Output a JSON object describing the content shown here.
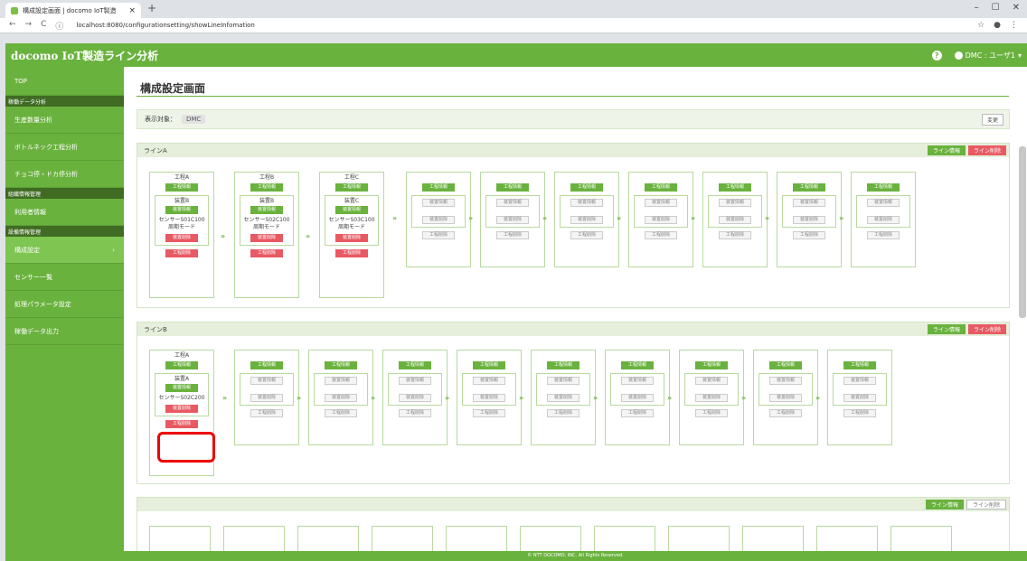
{
  "browser": {
    "tab_title": "構成設定画面 | docomo IoT製造",
    "url": "localhost:8080/configurationsetting/showLineInfomation"
  },
  "header": {
    "app_title": "docomo IoT製造ライン分析",
    "user": "DMC : ユーザ1"
  },
  "sidebar": {
    "top": "TOP",
    "group1": "稼働データ分析",
    "item_production": "生産数量分析",
    "item_bottleneck": "ボトルネック工程分析",
    "item_choko": "チョコ停・ドカ停分析",
    "group2": "組織情報管理",
    "item_users": "利用者情報",
    "group3": "設備情報管理",
    "item_config": "構成設定",
    "item_sensors": "センサー一覧",
    "item_params": "処理パラメータ設定",
    "item_export": "稼働データ出力"
  },
  "main": {
    "title": "構成設定画面",
    "target_label": "表示対象：",
    "target_value": "DMC",
    "change_btn": "変更",
    "line_info": "ライン情報",
    "line_delete": "ライン削除",
    "proc_info": "工程情報",
    "proc_delete": "工程削除",
    "dev_info": "装置情報",
    "dev_delete": "装置削除"
  },
  "lineA": {
    "name": "ラインA",
    "processes": [
      {
        "name": "工程A",
        "device": "装置B",
        "sensor1": "センサーS01C100",
        "sensor2": "周期モード"
      },
      {
        "name": "工程B",
        "device": "装置B",
        "sensor1": "センサーS02C100",
        "sensor2": "周期モード"
      },
      {
        "name": "工程C",
        "device": "装置C",
        "sensor1": "センサーS03C100",
        "sensor2": "周期モード"
      }
    ]
  },
  "lineB": {
    "name": "ラインB",
    "processes": [
      {
        "name": "工程A",
        "device": "装置A",
        "sensor1": "センサーS02C200",
        "sensor2": ""
      }
    ]
  },
  "footer": "© NTT DOCOMO, INC. All Rights Reserved."
}
